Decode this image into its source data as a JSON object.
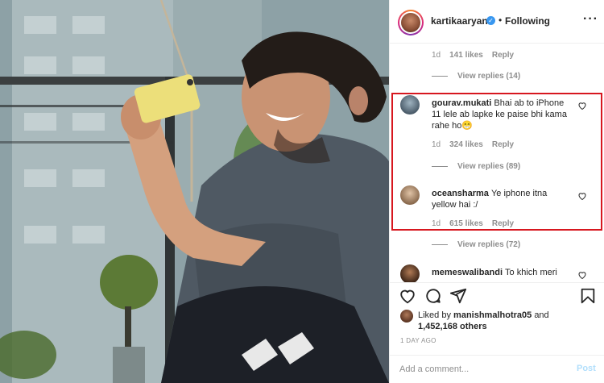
{
  "post": {
    "username": "kartikaaryan",
    "verified_icon": "verified-badge-icon",
    "separator": "•",
    "following_label": "Following",
    "more_icon": "more-options-icon"
  },
  "comments_top": {
    "age": "1d",
    "likes": "141 likes",
    "reply_label": "Reply",
    "view_replies": "View replies (14)"
  },
  "comments": [
    {
      "username": "gourav.mukati",
      "text": "Bhai ab to iPhone 11 lele ab lapke ke paise bhi kama rahe ho😁",
      "age": "1d",
      "likes": "324 likes",
      "reply_label": "Reply",
      "view_replies": "View replies (89)"
    },
    {
      "username": "oceansharma",
      "text": "Ye iphone itna yellow hai :/",
      "age": "1d",
      "likes": "615 likes",
      "reply_label": "Reply",
      "view_replies": "View replies (72)"
    },
    {
      "username": "memeswalibandi",
      "text": "To khich meri"
    }
  ],
  "highlight_color": "#d7171f",
  "actions": {
    "like_icon": "heart-icon",
    "comment_icon": "comment-icon",
    "share_icon": "share-icon",
    "save_icon": "bookmark-icon"
  },
  "likes": {
    "prefix": "Liked by",
    "user": "manishmalhotra05",
    "and": "and",
    "count": "1,452,168 others"
  },
  "time_ago": "1 DAY AGO",
  "add_comment": {
    "placeholder": "Add a comment...",
    "post_label": "Post"
  },
  "colors": {
    "accent_blue": "#3897f0",
    "muted": "#8e8e8e",
    "text": "#262626",
    "post_disabled": "#b2dffc"
  }
}
